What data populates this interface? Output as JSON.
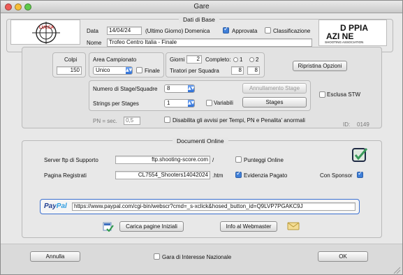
{
  "window": {
    "title": "Gare"
  },
  "header": {
    "group_title": "Dati di Base",
    "data_label": "Data",
    "data_value": "14/04/24",
    "day_note": "(Ultimo Giorno) Domenica",
    "approvata_label": "Approvata",
    "approvata": true,
    "classificazione_label": "Classificazione",
    "classificazione": false,
    "nome_label": "Nome",
    "nome_value": "Trofeo Centro Italia - Finale",
    "lucca_logo_text": "LUCCA",
    "doppia_logo_text_1": "D PPIA",
    "doppia_logo_text_2": "AZI NE",
    "doppia_logo_sub": "SHOOTING ASSOCIATION"
  },
  "colpi": {
    "label": "Colpi",
    "value": "150"
  },
  "campionato": {
    "label": "Area Campionato",
    "selected": "Unico",
    "finale_label": "Finale",
    "finale": false
  },
  "giorni": {
    "label": "Giorni",
    "value": "2",
    "completo_label": "Completo:",
    "opt1": "1",
    "opt2": "2",
    "tiratori_label": "Tiratori per Squadra",
    "tiratori_a": "8",
    "tiratori_b": "8"
  },
  "ripristina_button": "Ripristina Opzioni",
  "stages": {
    "numero_label": "Numero di Stage/Squadre",
    "numero_value": "8",
    "annullamento_button": "Annullamento Stage",
    "strings_label": "Strings per Stages",
    "strings_value": "1",
    "variabili_label": "Variabili",
    "variabili": false,
    "stages_button": "Stages"
  },
  "esclusa_stw_label": "Esclusa STW",
  "esclusa_stw": false,
  "pn": {
    "label": "PN = sec.",
    "value": "0,5"
  },
  "disabilita_label": "Disabilita gli avvisi per Tempi, PN e Penalita' anormali",
  "disabilita": false,
  "id_label": "ID:",
  "id_value": "0149",
  "online": {
    "group_title": "Documenti Online",
    "server_label": "Server ftp di Supporto",
    "server_value": "ftp.shooting-score.com",
    "server_suffix": "/",
    "punteggi_label": "Punteggi Online",
    "punteggi": false,
    "pagina_label": "Pagina Registrati",
    "pagina_value": "CL7554_Shooters14042024",
    "pagina_suffix": ".htm",
    "evidenzia_label": "Evidenzia Pagato",
    "evidenzia": true,
    "sponsor_label": "Con Sponsor",
    "sponsor": true,
    "paypal_label": "PayPal",
    "paypal_url": "https://www.paypal.com/cgi-bin/webscr?cmd=_s-xclick&hosed_button_id=Q9LVP7PGAKC9J",
    "carica_button": "Carica pagine Iniziali",
    "info_button": "Info al Webmaster"
  },
  "footer": {
    "annulla_button": "Annulla",
    "interesse_label": "Gara di Interesse Nazionale",
    "interesse": false,
    "ok_button": "OK"
  },
  "colors": {
    "accent": "#3f7fd8",
    "paypal_blue": "#1e3c8f",
    "paypal_light": "#2b9be0",
    "sponsor_green": "#3a9a5a"
  }
}
